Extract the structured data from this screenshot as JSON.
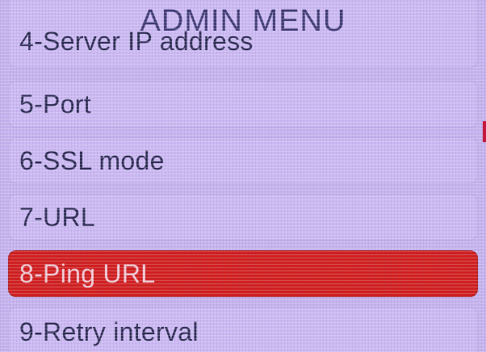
{
  "title": "ADMIN MENU",
  "menu": {
    "items": [
      {
        "label": "4-Server IP address",
        "selected": false
      },
      {
        "label": "5-Port",
        "selected": false
      },
      {
        "label": "6-SSL mode",
        "selected": false
      },
      {
        "label": "7-URL",
        "selected": false
      },
      {
        "label": "8-Ping URL",
        "selected": true
      },
      {
        "label": "9-Retry interval",
        "selected": false
      }
    ]
  },
  "colors": {
    "background": "#c5b3ee",
    "item": "#cbb9f2",
    "selected": "#d11f1f",
    "title_text": "#3f3a74",
    "item_text": "#2c2b52"
  }
}
